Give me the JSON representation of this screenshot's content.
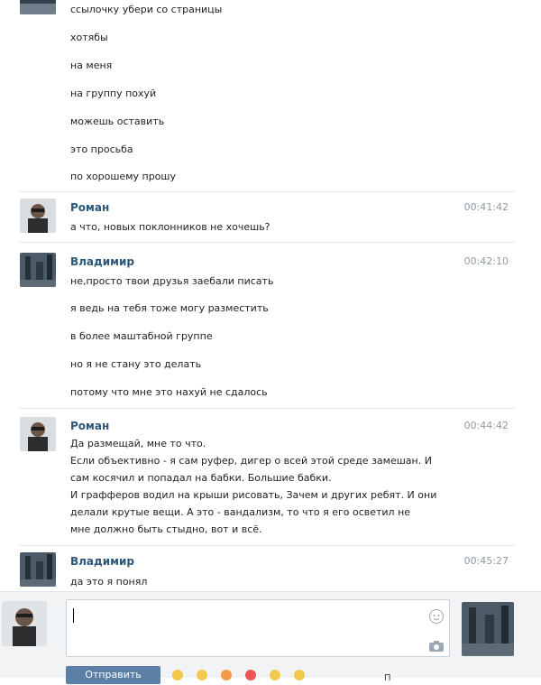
{
  "messages": [
    {
      "author": "",
      "time": "",
      "lines": [
        "ссылочку убери со страницы",
        "хотябы",
        "на меня",
        "на группу похуй",
        "можешь оставить",
        "это просьба",
        "по хорошему прошу"
      ]
    },
    {
      "author": "Роман",
      "time": "00:41:42",
      "lines": [
        "а что, новых поклонников не хочешь?"
      ]
    },
    {
      "author": "Владимир",
      "time": "00:42:10",
      "lines": [
        "не,просто твои друзья заебали писать",
        "я ведь на тебя тоже могу разместить",
        "в более маштабной группе",
        "но я не стану это делать",
        "потому что мне это нахуй не сдалось"
      ]
    },
    {
      "author": "Роман",
      "time": "00:44:42",
      "paragraph": "Да размещай, мне то что.\nЕсли объективно - я сам руфер, дигер о всей этой среде замешан. И\nсам косячил и попадал на бабки. Большие бабки.\nИ графферов водил на крыши рисовать, Зачем и других ребят. И они\nделали крутые вещи. А это - вандализм, то что я его осветил не\nмне должно быть стыдно, вот и всё."
    },
    {
      "author": "Владимир",
      "time": "00:45:27",
      "lines": [
        "да это я понял"
      ]
    }
  ],
  "composer": {
    "input_value": "",
    "send_label": "Отправить",
    "muted_text": "П"
  },
  "icons": {
    "emoji": "smile-icon",
    "attach_photo": "camera-icon"
  },
  "colors": {
    "author": "#2b587a",
    "time": "#8f9aa6",
    "send_button": "#5b7fa6"
  }
}
